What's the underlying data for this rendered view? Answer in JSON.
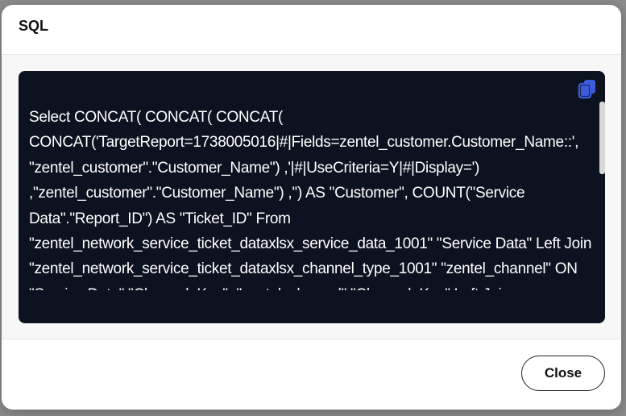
{
  "dialog": {
    "title": "SQL",
    "sql_text": "Select CONCAT( CONCAT( CONCAT( CONCAT('TargetReport=1738005016|#|Fields=zentel_customer.Customer_Name::', \"zentel_customer\".\"Customer_Name\") ,'|#|UseCriteria=Y|#|Display=') ,\"zentel_customer\".\"Customer_Name\") ,'') AS \"Customer\", COUNT(\"Service Data\".\"Report_ID\") AS \"Ticket_ID\" From \"zentel_network_service_ticket_dataxlsx_service_data_1001\" \"Service Data\" Left Join \"zentel_network_service_ticket_dataxlsx_channel_type_1001\" \"zentel_channel\" ON \"Service Data\".\"Channel_Key\"=\"zentel_channel\".\"Channel_Key\" Left Join",
    "copy_icon": "copy-icon",
    "close_label": "Close"
  },
  "colors": {
    "code_background": "#0d1220",
    "copy_icon_accent": "#3b5bdb"
  }
}
